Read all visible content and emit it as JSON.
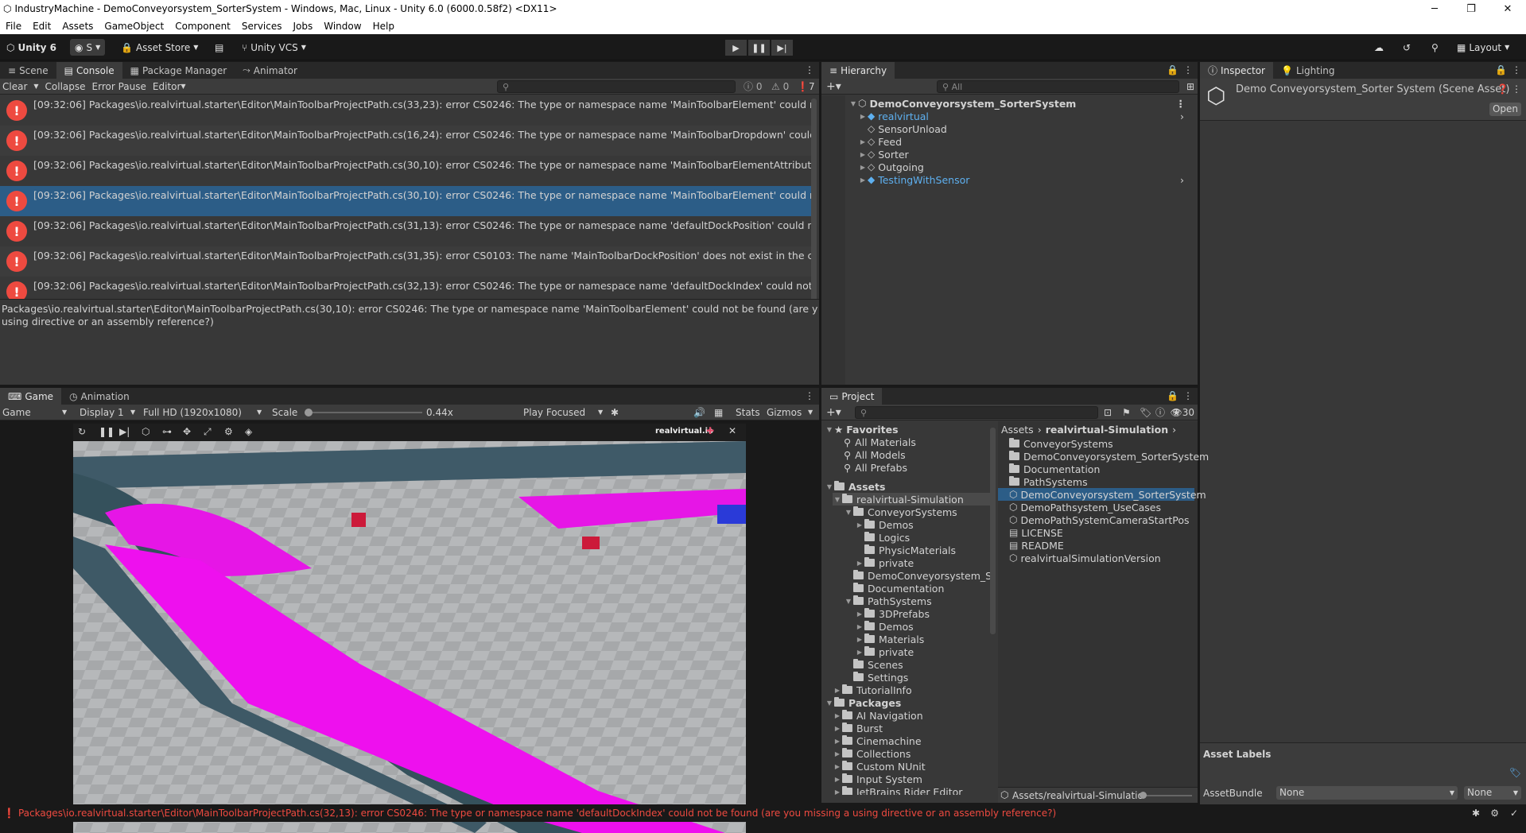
{
  "window": {
    "title": "IndustryMachine - DemoConveyorsystem_SorterSystem - Windows, Mac, Linux - Unity 6.0 (6000.0.58f2) <DX11>",
    "min_icon": "minimize-icon",
    "max_icon": "maximize-icon",
    "close_icon": "close-icon"
  },
  "menu": [
    "File",
    "Edit",
    "Assets",
    "GameObject",
    "Component",
    "Services",
    "Jobs",
    "Window",
    "Help"
  ],
  "toolbar": {
    "unity_label": "Unity 6",
    "account_label": "S",
    "asset_store_label": "Asset Store",
    "vcs_label": "Unity VCS",
    "layout_label": "Layout"
  },
  "console": {
    "tabs": [
      "Scene",
      "Console",
      "Package Manager",
      "Animator"
    ],
    "buttons": {
      "clear": "Clear",
      "collapse": "Collapse",
      "error_pause": "Error Pause",
      "editor": "Editor"
    },
    "counts": {
      "info": "0",
      "warn": "0",
      "error": "7"
    },
    "rows": [
      "[09:32:06] Packages\\io.realvirtual.starter\\Editor\\MainToolbarProjectPath.cs(33,23): error CS0246: The type or namespace name 'MainToolbarElement' could not be found (a",
      "[09:32:06] Packages\\io.realvirtual.starter\\Editor\\MainToolbarProjectPath.cs(16,24): error CS0246: The type or namespace name 'MainToolbarDropdown' could not be found",
      "[09:32:06] Packages\\io.realvirtual.starter\\Editor\\MainToolbarProjectPath.cs(30,10): error CS0246: The type or namespace name 'MainToolbarElementAttribute' could not be",
      "[09:32:06] Packages\\io.realvirtual.starter\\Editor\\MainToolbarProjectPath.cs(30,10): error CS0246: The type or namespace name 'MainToolbarElement' could not be found (ar",
      "[09:32:06] Packages\\io.realvirtual.starter\\Editor\\MainToolbarProjectPath.cs(31,13): error CS0246: The type or namespace name 'defaultDockPosition' could not be found (ar",
      "[09:32:06] Packages\\io.realvirtual.starter\\Editor\\MainToolbarProjectPath.cs(31,35): error CS0103: The name 'MainToolbarDockPosition' does not exist in the current context",
      "[09:32:06] Packages\\io.realvirtual.starter\\Editor\\MainToolbarProjectPath.cs(32,13): error CS0246: The type or namespace name 'defaultDockIndex' could not be found (are y"
    ],
    "detail_line1": "Packages\\io.realvirtual.starter\\Editor\\MainToolbarProjectPath.cs(30,10): error CS0246: The type or namespace name 'MainToolbarElement' could not be found (are you missing a",
    "detail_line2": "using directive or an assembly reference?)"
  },
  "hierarchy": {
    "tab": "Hierarchy",
    "search_placeholder": "All",
    "root": "DemoConveyorsystem_SorterSystem",
    "items": [
      "realvirtual",
      "SensorUnload",
      "Feed",
      "Sorter",
      "Outgoing",
      "TestingWithSensor"
    ]
  },
  "inspector": {
    "tabs": [
      "Inspector",
      "Lighting"
    ],
    "asset_title": "Demo Conveyorsystem_Sorter System (Scene Asset)",
    "open_button": "Open",
    "labels_title": "Asset Labels",
    "bundle_label": "AssetBundle",
    "bundle_value": "None",
    "variant_value": "None"
  },
  "game": {
    "tabs": [
      "Game",
      "Animation"
    ],
    "mode": "Game",
    "display": "Display 1",
    "resolution": "Full HD (1920x1080)",
    "scale_label": "Scale",
    "scale_value": "0.44x",
    "play_focus": "Play Focused",
    "stats": "Stats",
    "gizmos": "Gizmos",
    "brand": "realvirtual.io"
  },
  "project": {
    "tab": "Project",
    "hidden_count": "30",
    "breadcrumb_root": "Assets",
    "breadcrumb_current": "realvirtual-Simulation",
    "favorites_label": "Favorites",
    "favorites": [
      "All Materials",
      "All Models",
      "All Prefabs"
    ],
    "assets_label": "Assets",
    "tree": [
      "realvirtual-Simulation",
      "ConveyorSystems",
      "Demos",
      "Logics",
      "PhysicMaterials",
      "private",
      "DemoConveyorsystem_So",
      "Documentation",
      "PathSystems",
      "3DPrefabs",
      "Demos",
      "Materials",
      "private",
      "Scenes",
      "Settings",
      "TutorialInfo"
    ],
    "packages_label": "Packages",
    "packages": [
      "AI Navigation",
      "Burst",
      "Cinemachine",
      "Collections",
      "Custom NUnit",
      "Input System",
      "JetBrains Rider Editor"
    ],
    "files": [
      "ConveyorSystems",
      "DemoConveyorsystem_SorterSystem",
      "Documentation",
      "PathSystems",
      "DemoConveyorsystem_SorterSystem",
      "DemoPathsystem_UseCases",
      "DemoPathSystemCameraStartPos",
      "LICENSE",
      "README",
      "realvirtualSimulationVersion"
    ],
    "footer_path": "Assets/realvirtual-Simulatio"
  },
  "status": {
    "message": "Packages\\io.realvirtual.starter\\Editor\\MainToolbarProjectPath.cs(32,13): error CS0246: The type or namespace name 'defaultDockIndex' could not be found (are you missing a using directive or an assembly reference?)"
  },
  "colors": {
    "error": "#ee4a40",
    "selection": "#2c5d87",
    "magenta": "#ff00ff",
    "blue_link": "#5eb0f0"
  }
}
